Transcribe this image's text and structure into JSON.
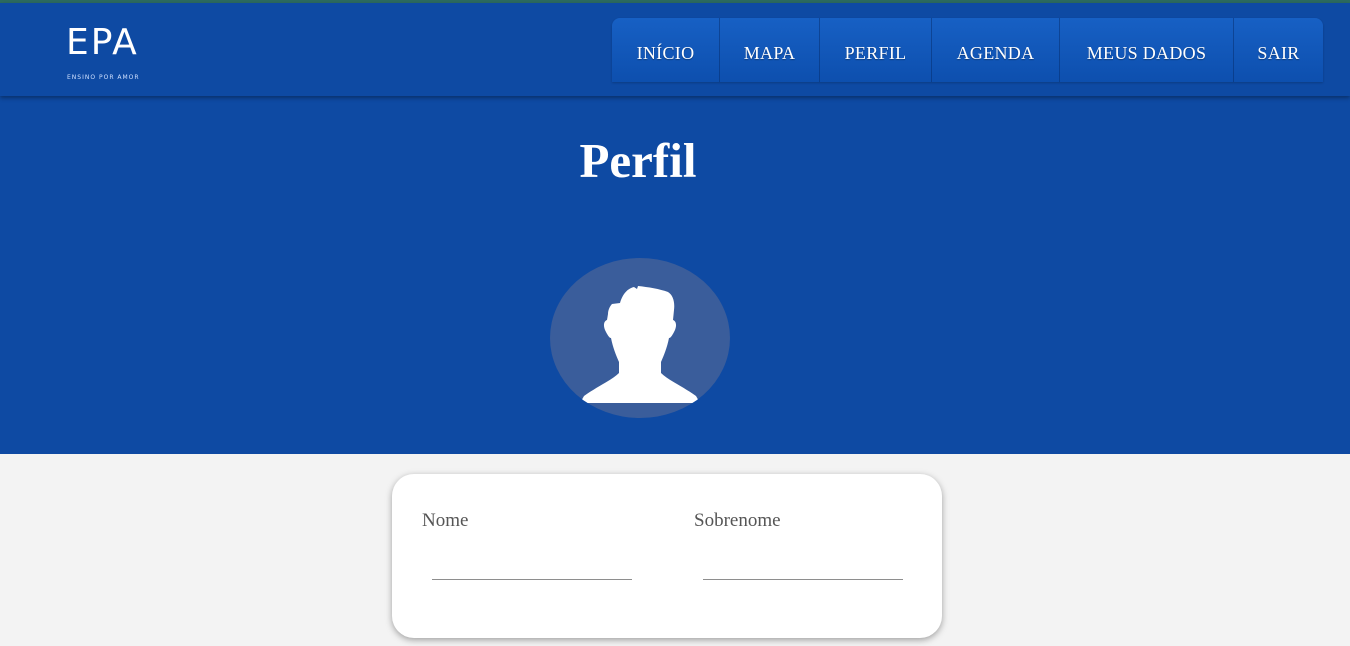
{
  "brand": {
    "logo_text": "EPA",
    "tagline": "ENSINO POR AMOR"
  },
  "nav": {
    "items": [
      {
        "label": "INÍCIO"
      },
      {
        "label": "MAPA"
      },
      {
        "label": "PERFIL"
      },
      {
        "label": "AGENDA"
      },
      {
        "label": "MEUS DADOS"
      },
      {
        "label": "SAIR"
      }
    ]
  },
  "hero": {
    "title": "Perfil",
    "avatar_icon": "user-silhouette-icon"
  },
  "form": {
    "first_name": {
      "label": "Nome",
      "value": "",
      "placeholder": ""
    },
    "last_name": {
      "label": "Sobrenome",
      "value": "",
      "placeholder": ""
    }
  },
  "colors": {
    "primary": "#0e4aa3",
    "menu": "#1760c4",
    "avatar_bg": "#3a5d9b",
    "page_bg": "#f3f3f3"
  }
}
